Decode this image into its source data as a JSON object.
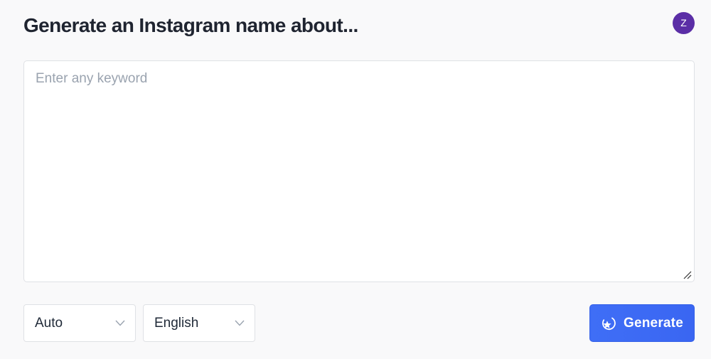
{
  "header": {
    "title": "Generate an Instagram name about...",
    "avatar_initial": "Z"
  },
  "keyword_input": {
    "placeholder": "Enter any keyword",
    "value": ""
  },
  "controls": {
    "tone_select": {
      "selected": "Auto"
    },
    "language_select": {
      "selected": "English"
    },
    "generate_button": {
      "label": "Generate",
      "icon": "sparkle-icon"
    }
  },
  "colors": {
    "background": "#f9f9fa",
    "accent": "#3f6ef6",
    "avatar": "#5b2ea6",
    "border": "#dfe1e5"
  }
}
